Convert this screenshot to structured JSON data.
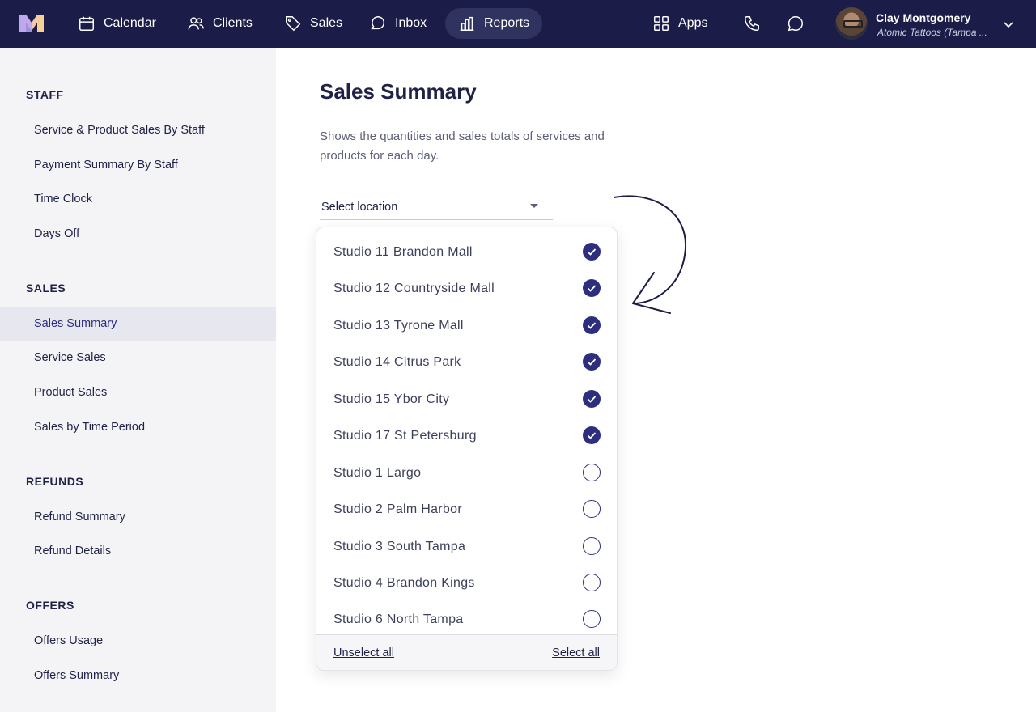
{
  "topbar": {
    "nav": [
      {
        "label": "Calendar",
        "icon": "calendar-icon"
      },
      {
        "label": "Clients",
        "icon": "users-icon"
      },
      {
        "label": "Sales",
        "icon": "tag-icon"
      },
      {
        "label": "Inbox",
        "icon": "chat-icon"
      },
      {
        "label": "Reports",
        "icon": "bar-chart-icon",
        "active": true
      }
    ],
    "apps_label": "Apps",
    "user": {
      "name": "Clay Montgomery",
      "business": "Atomic Tattoos (Tampa ..."
    }
  },
  "sidebar": {
    "sections": [
      {
        "heading": "STAFF",
        "items": [
          "Service & Product Sales By Staff",
          "Payment Summary By Staff",
          "Time Clock",
          "Days Off"
        ]
      },
      {
        "heading": "SALES",
        "items": [
          "Sales Summary",
          "Service Sales",
          "Product Sales",
          "Sales by Time Period"
        ]
      },
      {
        "heading": "REFUNDS",
        "items": [
          "Refund Summary",
          "Refund Details"
        ]
      },
      {
        "heading": "OFFERS",
        "items": [
          "Offers Usage",
          "Offers Summary"
        ]
      }
    ],
    "active_item": "Sales Summary"
  },
  "main": {
    "title": "Sales Summary",
    "description": "Shows the quantities and sales totals of services and products for each day.",
    "location_select": {
      "placeholder": "Select location"
    }
  },
  "dropdown": {
    "options": [
      {
        "label": "Studio 11 Brandon Mall",
        "checked": true
      },
      {
        "label": "Studio 12 Countryside Mall",
        "checked": true
      },
      {
        "label": "Studio 13 Tyrone Mall",
        "checked": true
      },
      {
        "label": "Studio 14 Citrus Park",
        "checked": true
      },
      {
        "label": "Studio 15 Ybor City",
        "checked": true
      },
      {
        "label": "Studio 17 St Petersburg",
        "checked": true
      },
      {
        "label": "Studio 1 Largo",
        "checked": false
      },
      {
        "label": "Studio 2 Palm Harbor",
        "checked": false
      },
      {
        "label": "Studio 3 South Tampa",
        "checked": false
      },
      {
        "label": "Studio 4 Brandon Kings",
        "checked": false
      },
      {
        "label": "Studio 6 North Tampa",
        "checked": false
      }
    ],
    "unselect_all": "Unselect all",
    "select_all": "Select all"
  },
  "colors": {
    "nav_bg": "#1b1d48",
    "accent": "#2d2f7e",
    "sidebar_bg": "#f4f4f6"
  }
}
